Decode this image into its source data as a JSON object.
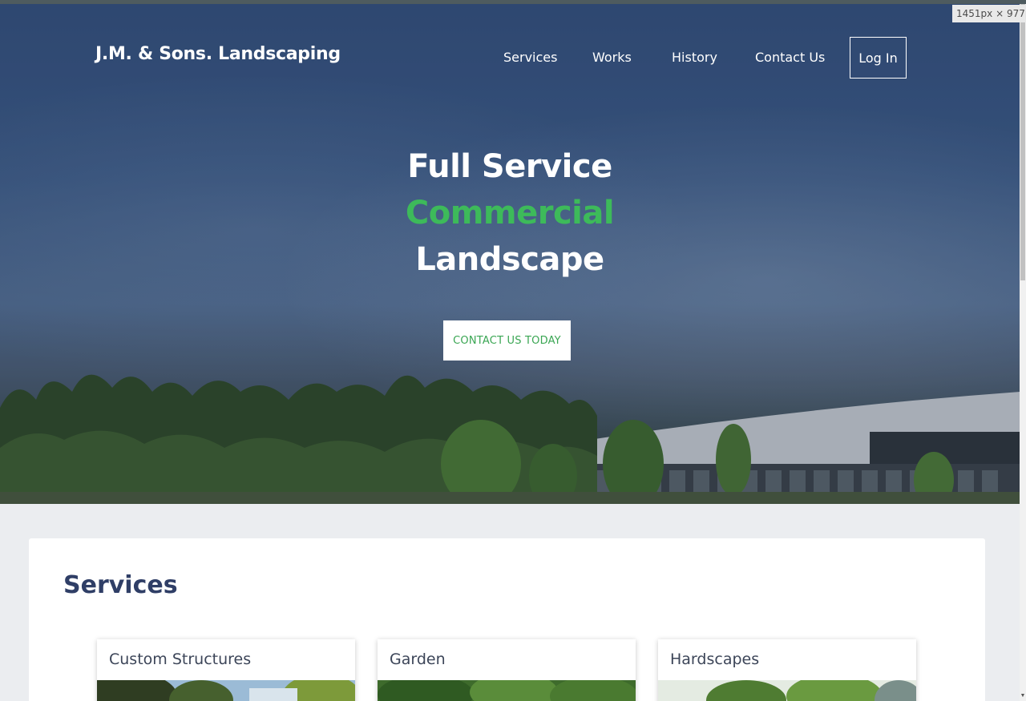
{
  "header": {
    "brand": "J.M. & Sons. Landscaping",
    "nav": [
      "Services",
      "Works",
      "History",
      "Contact Us"
    ],
    "login_label": "Log In"
  },
  "size_readout": "1451px × 977px",
  "hero": {
    "line1": "Full Service",
    "line2": "Commercial",
    "line3": "Landscape",
    "cta_label": "CONTACT US TODAY"
  },
  "services": {
    "title": "Services",
    "cards": [
      {
        "title": "Custom Structures"
      },
      {
        "title": "Garden"
      },
      {
        "title": "Hardscapes"
      }
    ]
  },
  "colors": {
    "accent_green": "#3dba5a",
    "heading_navy": "#2f3e66",
    "page_bg": "#ebedf0"
  }
}
